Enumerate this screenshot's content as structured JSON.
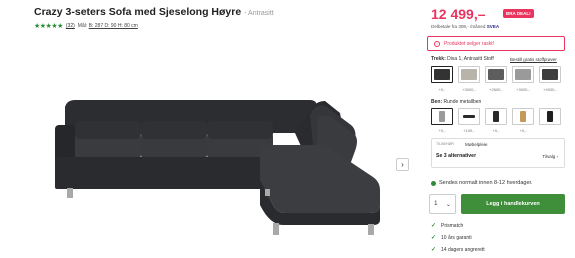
{
  "product": {
    "title": "Crazy 3-seters Sofa med Sjeselong Høyre",
    "variant": "- Antrasitt",
    "stars": "★★★★★",
    "review_count": "(32)",
    "dims_prefix": "Mål:",
    "dims_value": "B: 287 D: 90 H: 80 cm"
  },
  "gallery": {
    "next_arrow": "›"
  },
  "price": {
    "amount": "12 499,–",
    "badge": "BRA DEAL!",
    "installment_prefix": "Delbetale fra 308,- /måned",
    "installment_provider": "SVEA"
  },
  "alert": {
    "icon": "!",
    "text": "Produktet selger raskt!"
  },
  "fabric": {
    "label": "Trekk:",
    "value": "Disa 1, Antrasitt Stoff",
    "link": "Bestill gratis stoffprøver",
    "swatches": [
      {
        "color": "#333333",
        "price": "+0,-"
      },
      {
        "color": "#b9b4aa",
        "price": "+3000,-"
      },
      {
        "color": "#5d5d5d",
        "price": "+2600,-"
      },
      {
        "color": "#9a9a9a",
        "price": "+3000,-"
      },
      {
        "color": "#3d3d3d",
        "price": "+4000,-"
      }
    ]
  },
  "legs": {
    "label": "Ben:",
    "value": "Runde metallben",
    "swatches": [
      {
        "color": "#9a9a9a",
        "price": "+0,-"
      },
      {
        "color": "#2a2a2a",
        "price": "+100,-"
      },
      {
        "color": "#2a2a2a",
        "price": "+0,-"
      },
      {
        "color": "#c39a5a",
        "price": "+0,-"
      },
      {
        "color": "#1f1f1f",
        "price": "+0,-"
      }
    ],
    "more": "+2"
  },
  "accessory": {
    "tag": "TILBEHØR",
    "name": "Møbelpleie",
    "cta": "Se 3 alternativer",
    "select_label": "Tilvalg ›"
  },
  "shipping": {
    "text": "Sendes normalt innen 8-12 hverdager."
  },
  "cart": {
    "qty": "1",
    "qty_arrow": "⌄",
    "add_label": "Legg i handlekurven"
  },
  "usps": [
    {
      "icon": "✓",
      "text": "Prismatch"
    },
    {
      "icon": "✓",
      "text": "10 års garanti"
    },
    {
      "icon": "✓",
      "text": "14 dagers angrerett"
    }
  ],
  "colors": {
    "accent": "#e8345e",
    "cta_green": "#3e8e3a",
    "sofa": "#2f3033"
  }
}
